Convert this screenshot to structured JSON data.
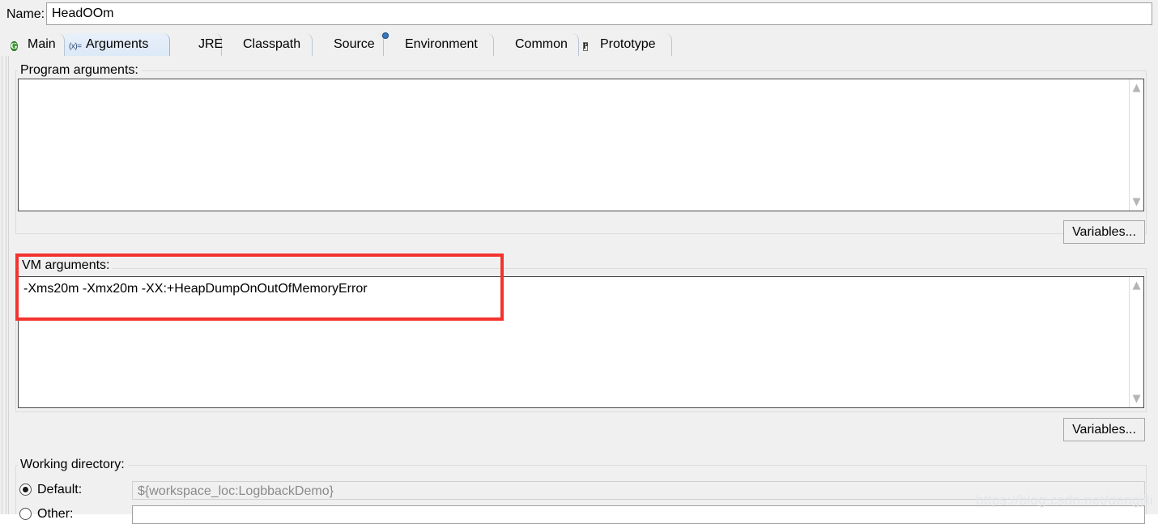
{
  "name_row": {
    "label": "Name:",
    "value": "HeadOOm"
  },
  "tabs": [
    {
      "label": "Main",
      "icon": "green-circle-g-icon",
      "selected": false
    },
    {
      "label": "Arguments",
      "icon": "variable-xeq-icon",
      "selected": true
    },
    {
      "label": "JRE",
      "icon": "books-stack-icon",
      "selected": false
    },
    {
      "label": "Classpath",
      "icon": "yellow-nodes-icon",
      "selected": false
    },
    {
      "label": "Source",
      "icon": "pencil-edit-icon",
      "selected": false
    },
    {
      "label": "Environment",
      "icon": "blue-window-icon",
      "selected": false
    },
    {
      "label": "Common",
      "icon": "table-window-icon",
      "selected": false
    },
    {
      "label": "Prototype",
      "icon": "letter-p-box-icon",
      "selected": false
    }
  ],
  "program_arguments": {
    "label": "Program arguments:",
    "value": "",
    "variables_button": "Variables..."
  },
  "vm_arguments": {
    "label": "VM arguments:",
    "value": "-Xms20m -Xmx20m -XX:+HeapDumpOnOutOfMemoryError",
    "variables_button": "Variables..."
  },
  "working_directory": {
    "label": "Working directory:",
    "default_label": "Default:",
    "default_value": "${workspace_loc:LogbbackDemo}",
    "default_selected": true,
    "other_label": "Other:",
    "other_value": "",
    "other_selected": false
  },
  "annotation": {
    "highlight_color": "#f4332f"
  },
  "watermark": "https://blog.csdn.net/dengjili"
}
